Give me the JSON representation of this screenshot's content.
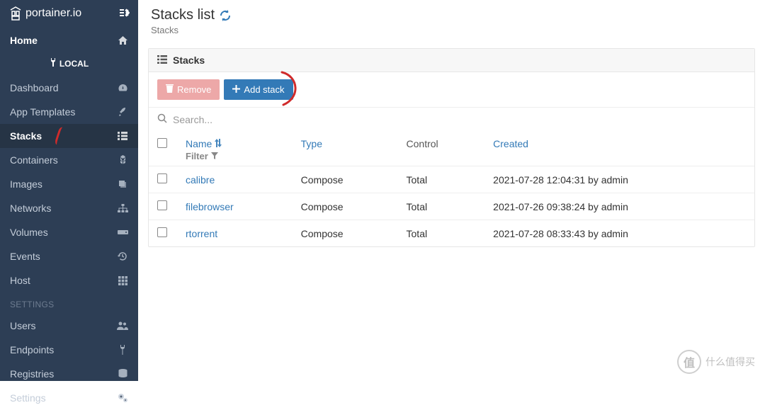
{
  "brand": "portainer.io",
  "local_label": "LOCAL",
  "sidebar": {
    "items": [
      {
        "label": "Home",
        "icon": "home-icon"
      },
      {
        "label": "Dashboard",
        "icon": "gauge-icon"
      },
      {
        "label": "App Templates",
        "icon": "rocket-icon"
      },
      {
        "label": "Stacks",
        "icon": "list-icon",
        "active": true
      },
      {
        "label": "Containers",
        "icon": "cubes-icon"
      },
      {
        "label": "Images",
        "icon": "layers-icon"
      },
      {
        "label": "Networks",
        "icon": "sitemap-icon"
      },
      {
        "label": "Volumes",
        "icon": "hdd-icon"
      },
      {
        "label": "Events",
        "icon": "history-icon"
      },
      {
        "label": "Host",
        "icon": "grid-icon"
      }
    ],
    "settings_header": "SETTINGS",
    "settings_items": [
      {
        "label": "Users",
        "icon": "users-icon"
      },
      {
        "label": "Endpoints",
        "icon": "plug-icon"
      },
      {
        "label": "Registries",
        "icon": "database-icon"
      },
      {
        "label": "Settings",
        "icon": "gears-icon"
      }
    ]
  },
  "header": {
    "title": "Stacks list",
    "breadcrumb": "Stacks"
  },
  "panel": {
    "title": "Stacks",
    "remove_label": "Remove",
    "add_label": "Add stack",
    "search_placeholder": "Search...",
    "columns": {
      "name": "Name",
      "type": "Type",
      "control": "Control",
      "created": "Created"
    },
    "filter_label": "Filter",
    "rows": [
      {
        "name": "calibre",
        "type": "Compose",
        "control": "Total",
        "created": "2021-07-28 12:04:31 by admin"
      },
      {
        "name": "filebrowser",
        "type": "Compose",
        "control": "Total",
        "created": "2021-07-26 09:38:24 by admin"
      },
      {
        "name": "rtorrent",
        "type": "Compose",
        "control": "Total",
        "created": "2021-07-28 08:33:43 by admin"
      }
    ]
  },
  "watermark": "什么值得买"
}
